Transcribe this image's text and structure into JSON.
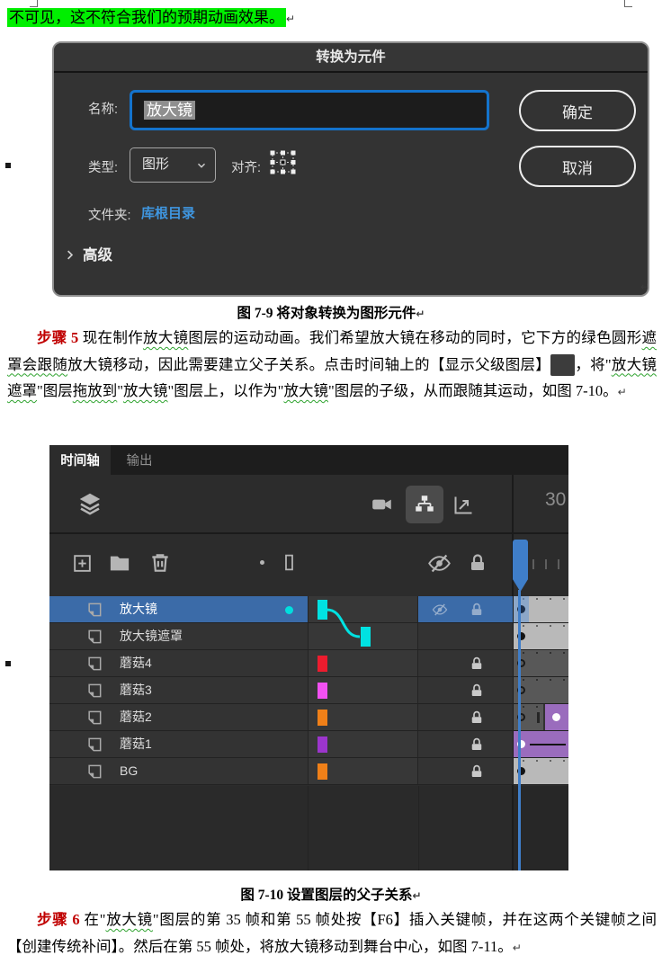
{
  "page": {
    "highlight_text": "不可见，这不符合我们的预期动画效果。",
    "pilcrow": "↵"
  },
  "dialog": {
    "title": "转换为元件",
    "name_label": "名称:",
    "name_value": "放大镜",
    "ok_label": "确定",
    "type_label": "类型:",
    "type_value": "图形",
    "align_label": "对齐:",
    "cancel_label": "取消",
    "folder_label": "文件夹:",
    "folder_value": "库根目录",
    "advanced_label": "高级",
    "accent_blue": "#1473cc",
    "link_blue": "#3f96e0",
    "icons": [
      "chevron-down-icon",
      "chevron-right-icon",
      "registration-grid-icon"
    ]
  },
  "fig9": {
    "caption": "图 7-9 将对象转换为图形元件",
    "mark": "↵"
  },
  "step5_segments": [
    {
      "t": "步骤 5",
      "c": "step"
    },
    {
      "t": " 现在制作",
      "c": "p"
    },
    {
      "t": "放大镜",
      "c": "w"
    },
    {
      "t": "图层的运动动画。我们希望放大镜在移动的同时，它下方的绿色圆形",
      "c": "p"
    },
    {
      "t": "遮罩会跟随",
      "c": "w"
    },
    {
      "t": "放大镜移动，因此需要建立父子关系。点击时间轴上的【显示父级图层】",
      "c": "p"
    },
    {
      "t": "",
      "c": "icon"
    },
    {
      "t": "，将\"",
      "c": "p"
    },
    {
      "t": "放大镜遮罩",
      "c": "w"
    },
    {
      "t": "\"图层",
      "c": "p"
    },
    {
      "t": "拖放到",
      "c": "w"
    },
    {
      "t": "\"",
      "c": "p"
    },
    {
      "t": "放大镜",
      "c": "w"
    },
    {
      "t": "\"图层上，以作为\"",
      "c": "p"
    },
    {
      "t": "放大镜",
      "c": "w"
    },
    {
      "t": "\"图层的子级，从而跟随其运动，如图 7-10。",
      "c": "p"
    },
    {
      "t": "↵",
      "c": "mark"
    }
  ],
  "timeline": {
    "tabs": [
      {
        "label": "时间轴",
        "active": true
      },
      {
        "label": "输出",
        "active": false
      }
    ],
    "toolbar_icons": [
      "layers-icon",
      "camera-icon",
      "show-parent-layers-icon",
      "graph-editor-icon",
      "add-layer-icon",
      "folder-icon",
      "trash-icon",
      "highlight-dot-icon",
      "outline-rect-icon",
      "eye-slash-icon",
      "lock-icon"
    ],
    "ruler_label": "30",
    "playhead_color": "#3f7ec9",
    "selection_blue": "#3b6ba8",
    "wire_cyan": "#00e2e2",
    "layers": [
      {
        "name": "放大镜",
        "selected": true,
        "hidden": true,
        "locked": true,
        "parent_marker": true,
        "keyframe": "filled, at playhead"
      },
      {
        "name": "放大镜遮罩",
        "child_of": "放大镜",
        "keyframe": "filled"
      },
      {
        "name": "蘑菇4",
        "color": "#ed1c2e",
        "locked": true,
        "keyframe": "hollow"
      },
      {
        "name": "蘑菇3",
        "color": "#f251f2",
        "locked": true,
        "keyframe": "hollow"
      },
      {
        "name": "蘑菇2",
        "color": "#f08018",
        "locked": true,
        "keyframe": "hollow then tween span with keyframe"
      },
      {
        "name": "蘑菇1",
        "color": "#9c35cc",
        "locked": true,
        "keyframe": "tween span with keyframe"
      },
      {
        "name": "BG",
        "color": "#f08018",
        "locked": true,
        "keyframe": "filled"
      }
    ]
  },
  "fig10": {
    "caption": "图 7-10 设置图层的父子关系",
    "mark": "↵"
  },
  "step6_segments": [
    {
      "t": "步骤 6",
      "c": "step"
    },
    {
      "t": " 在\"",
      "c": "p"
    },
    {
      "t": "放大镜",
      "c": "w"
    },
    {
      "t": "\"图层的第 35 帧和第 55 帧处按【F6】插入关键帧，并在这两个关键帧之间【创建传统补间】。然后在第 55 帧处，将放大镜移动到舞台中心，如图 7-11。",
      "c": "p"
    },
    {
      "t": "↵",
      "c": "mark"
    }
  ]
}
